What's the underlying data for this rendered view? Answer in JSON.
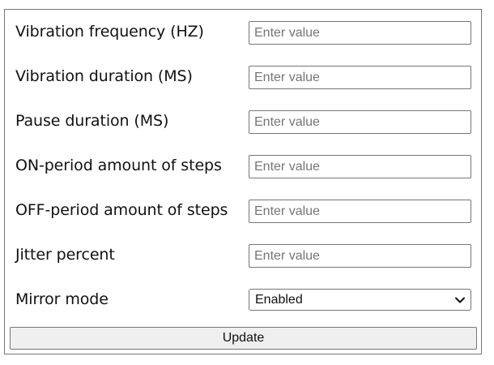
{
  "fields": [
    {
      "label": "Vibration frequency (HZ)",
      "placeholder": "Enter value",
      "value": ""
    },
    {
      "label": "Vibration duration (MS)",
      "placeholder": "Enter value",
      "value": ""
    },
    {
      "label": "Pause duration (MS)",
      "placeholder": "Enter value",
      "value": ""
    },
    {
      "label": "ON-period amount of steps",
      "placeholder": "Enter value",
      "value": ""
    },
    {
      "label": "OFF-period amount of steps",
      "placeholder": "Enter value",
      "value": ""
    },
    {
      "label": "Jitter percent",
      "placeholder": "Enter value",
      "value": ""
    }
  ],
  "mirror_mode": {
    "label": "Mirror mode",
    "selected": "Enabled",
    "icon": "chevron-down-icon"
  },
  "update_button": {
    "label": "Update"
  }
}
